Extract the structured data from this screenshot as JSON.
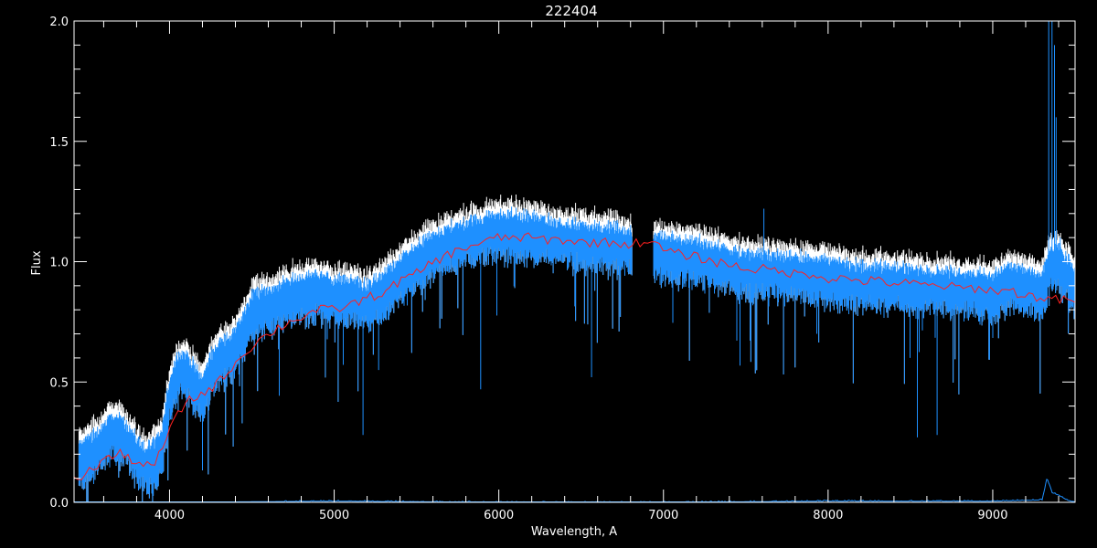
{
  "chart_data": {
    "type": "line",
    "title": "222404",
    "xlabel": "Wavelength, A",
    "ylabel": "Flux",
    "xlim": [
      3420,
      9500
    ],
    "ylim": [
      0,
      2.0
    ],
    "grid": false,
    "legend": "none",
    "colors": {
      "background": "#000000",
      "axes": "#ffffff",
      "observed": "#1e90ff",
      "observed_upper": "#ffffff",
      "model": "#ff2020",
      "error": "#1e90ff"
    },
    "x_ticks": [
      {
        "value": 4000,
        "label": "4000"
      },
      {
        "value": 5000,
        "label": "5000"
      },
      {
        "value": 6000,
        "label": "6000"
      },
      {
        "value": 7000,
        "label": "7000"
      },
      {
        "value": 8000,
        "label": "8000"
      },
      {
        "value": 9000,
        "label": "9000"
      }
    ],
    "y_ticks": [
      {
        "value": 0.0,
        "label": "0.0"
      },
      {
        "value": 0.5,
        "label": "0.5"
      },
      {
        "value": 1.0,
        "label": "1.0"
      },
      {
        "value": 1.5,
        "label": "1.5"
      },
      {
        "value": 2.0,
        "label": "2.0"
      }
    ],
    "series": [
      {
        "role": "observed",
        "x": [
          3450,
          3500,
          3550,
          3600,
          3650,
          3700,
          3750,
          3800,
          3850,
          3900,
          3950,
          4000,
          4050,
          4100,
          4150,
          4200,
          4250,
          4300,
          4350,
          4400,
          4450,
          4500,
          4600,
          4700,
          4800,
          4900,
          5000,
          5100,
          5200,
          5300,
          5400,
          5500,
          5600,
          5700,
          5800,
          5900,
          6000,
          6100,
          6200,
          6300,
          6400,
          6500,
          6600,
          6700,
          6800,
          6950,
          7000,
          7100,
          7200,
          7300,
          7400,
          7500,
          7600,
          7700,
          7800,
          7900,
          8000,
          8100,
          8200,
          8300,
          8400,
          8500,
          8600,
          8700,
          8800,
          8900,
          9000,
          9100,
          9200,
          9300,
          9350,
          9400,
          9450,
          9500
        ],
        "y": [
          0.17,
          0.2,
          0.22,
          0.26,
          0.3,
          0.28,
          0.25,
          0.2,
          0.16,
          0.18,
          0.22,
          0.45,
          0.55,
          0.55,
          0.5,
          0.45,
          0.55,
          0.6,
          0.62,
          0.65,
          0.72,
          0.8,
          0.82,
          0.85,
          0.87,
          0.88,
          0.86,
          0.86,
          0.84,
          0.88,
          0.95,
          1.0,
          1.05,
          1.08,
          1.1,
          1.12,
          1.13,
          1.13,
          1.12,
          1.11,
          1.1,
          1.09,
          1.08,
          1.08,
          1.06,
          1.05,
          1.04,
          1.03,
          1.02,
          1.01,
          0.99,
          0.97,
          0.97,
          0.96,
          0.96,
          0.95,
          0.94,
          0.93,
          0.92,
          0.92,
          0.91,
          0.91,
          0.9,
          0.9,
          0.89,
          0.89,
          0.88,
          0.92,
          0.9,
          0.88,
          1.0,
          1.0,
          0.95,
          0.9
        ]
      },
      {
        "role": "model",
        "x": [
          3420,
          3500,
          3600,
          3700,
          3800,
          3900,
          4000,
          4100,
          4200,
          4300,
          4400,
          4500,
          4600,
          4700,
          4800,
          4900,
          5000,
          5100,
          5200,
          5300,
          5400,
          5500,
          5600,
          5700,
          5800,
          5900,
          6000,
          6100,
          6200,
          6300,
          6400,
          6500,
          6600,
          6700,
          6800,
          6900,
          7000,
          7100,
          7200,
          7300,
          7400,
          7500,
          7600,
          7700,
          7800,
          7900,
          8000,
          8100,
          8200,
          8300,
          8400,
          8500,
          8600,
          8700,
          8800,
          8900,
          9000,
          9100,
          9200,
          9300,
          9400,
          9500
        ],
        "y": [
          0.09,
          0.12,
          0.18,
          0.2,
          0.17,
          0.14,
          0.3,
          0.42,
          0.45,
          0.5,
          0.58,
          0.65,
          0.7,
          0.74,
          0.77,
          0.8,
          0.8,
          0.82,
          0.85,
          0.87,
          0.92,
          0.95,
          1.0,
          1.03,
          1.06,
          1.08,
          1.1,
          1.1,
          1.1,
          1.09,
          1.09,
          1.08,
          1.08,
          1.08,
          1.07,
          1.09,
          1.05,
          1.03,
          1.02,
          1.0,
          0.99,
          0.97,
          0.97,
          0.96,
          0.95,
          0.95,
          0.93,
          0.93,
          0.92,
          0.92,
          0.91,
          0.91,
          0.9,
          0.9,
          0.89,
          0.89,
          0.88,
          0.88,
          0.86,
          0.85,
          0.84,
          0.84
        ]
      },
      {
        "role": "error",
        "x": [
          3420,
          4000,
          5000,
          6000,
          7000,
          8000,
          9000,
          9300,
          9330,
          9360,
          9400,
          9450,
          9500
        ],
        "y": [
          0.0,
          0.0,
          0.005,
          0.0,
          0.0,
          0.005,
          0.005,
          0.01,
          0.1,
          0.04,
          0.03,
          0.01,
          0.0
        ]
      }
    ]
  }
}
